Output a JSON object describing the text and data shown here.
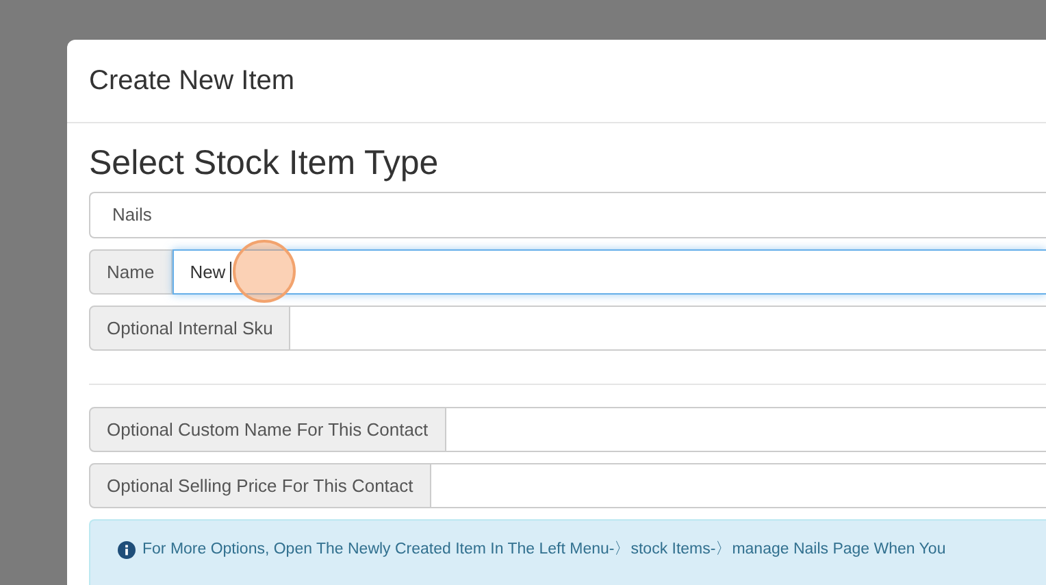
{
  "modal": {
    "title": "Create New Item"
  },
  "form": {
    "heading": "Select Stock Item Type",
    "type_select": {
      "value": "Nails"
    },
    "fields": [
      {
        "label": "Name",
        "value": "New ",
        "focused": true
      },
      {
        "label": "Optional Internal Sku",
        "focused": false
      }
    ],
    "contact_fields": [
      {
        "label": "Optional Custom Name For This Contact",
        "focused": false
      },
      {
        "label": "Optional Selling Price For This Contact",
        "focused": false
      }
    ],
    "info": "For More Options, Open The Newly Created Item In The Left Menu-〉stock Items-〉manage Nails Page When You"
  }
}
